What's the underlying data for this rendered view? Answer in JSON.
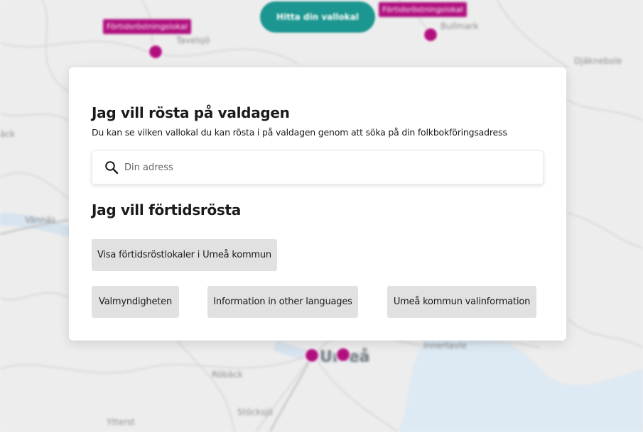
{
  "map": {
    "find_button_label": "Hitta din vallokal",
    "pins": [
      {
        "label": "Förtidsröstningslokal"
      },
      {
        "label": "Förtidsröstningslokal"
      }
    ],
    "place_labels": {
      "tavelsjo": "Tavelsjö",
      "bullmark": "Bullmark",
      "djaknebole": "Djäknebole",
      "vannas": "Vännäs",
      "roback": "Röbäck",
      "umea": "Umeå",
      "stocksjo": "Stöcksjö",
      "ytterstfors": "Ytterst",
      "innertavle": "Innertavle",
      "ack": "äck"
    },
    "colors": {
      "pin": "#b0107e",
      "find_button": "#1c9690",
      "water": "#dde9f3"
    }
  },
  "modal": {
    "valdagen": {
      "heading": "Jag vill rösta på valdagen",
      "description": "Du kan se vilken vallokal du kan rösta i på valdagen genom att söka på din folkbokföringsadress",
      "search": {
        "icon": "search-icon",
        "placeholder": "Din adress",
        "value": ""
      }
    },
    "fortids": {
      "heading": "Jag vill förtidsrösta",
      "show_button_label": "Visa förtidsröstlokaler i Umeå kommun"
    },
    "links": {
      "valmyndigheten": "Valmyndigheten",
      "other_languages": "Information in other languages",
      "umea_info": "Umeå kommun valinformation"
    }
  }
}
